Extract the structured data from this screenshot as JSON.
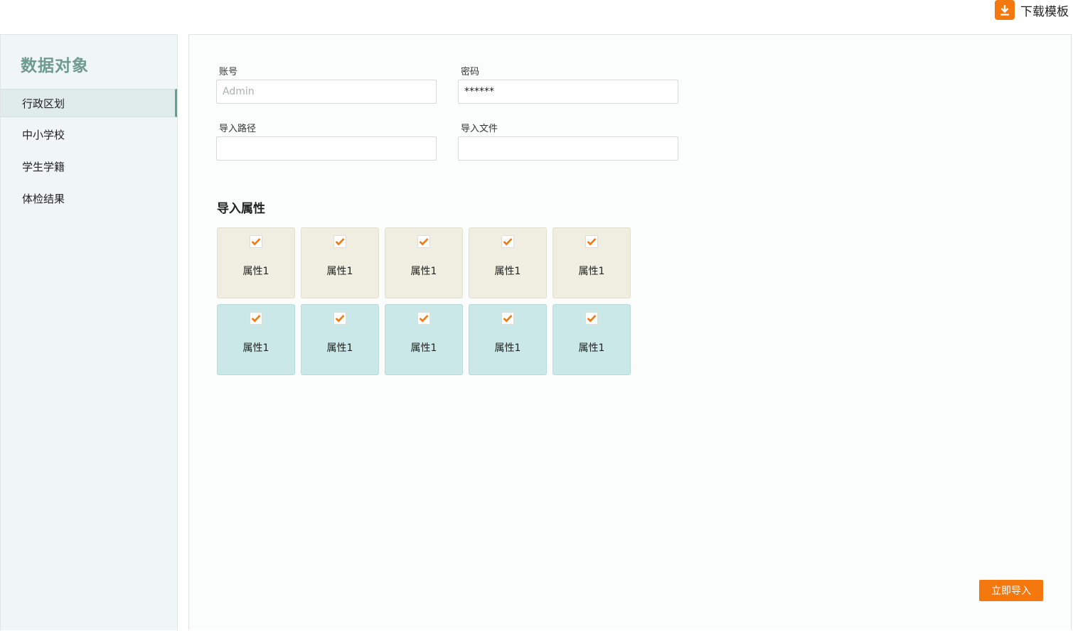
{
  "header": {
    "download_label": "下载模板",
    "download_icon": "download-icon"
  },
  "sidebar": {
    "title": "数据对象",
    "items": [
      {
        "label": "行政区划",
        "active": true
      },
      {
        "label": "中小学校",
        "active": false
      },
      {
        "label": "学生学籍",
        "active": false
      },
      {
        "label": "体检结果",
        "active": false
      }
    ]
  },
  "form": {
    "account": {
      "label": "账号",
      "placeholder": "Admin",
      "value": ""
    },
    "password": {
      "label": "密码",
      "value": "******"
    },
    "import_path": {
      "label": "导入路径",
      "value": ""
    },
    "import_file": {
      "label": "导入文件",
      "value": ""
    }
  },
  "attributes": {
    "title": "导入属性",
    "rows": [
      {
        "tone": "beige",
        "items": [
          {
            "label": "属性1",
            "checked": true
          },
          {
            "label": "属性1",
            "checked": true
          },
          {
            "label": "属性1",
            "checked": true
          },
          {
            "label": "属性1",
            "checked": true
          },
          {
            "label": "属性1",
            "checked": true
          }
        ]
      },
      {
        "tone": "teal",
        "items": [
          {
            "label": "属性1",
            "checked": true
          },
          {
            "label": "属性1",
            "checked": true
          },
          {
            "label": "属性1",
            "checked": true
          },
          {
            "label": "属性1",
            "checked": true
          },
          {
            "label": "属性1",
            "checked": true
          }
        ]
      }
    ]
  },
  "actions": {
    "submit_label": "立即导入"
  },
  "colors": {
    "accent": "#f5780f",
    "sidebar_title": "#6f9a8f",
    "tile_beige": "#f0ede1",
    "tile_teal": "#cbe8e9"
  }
}
